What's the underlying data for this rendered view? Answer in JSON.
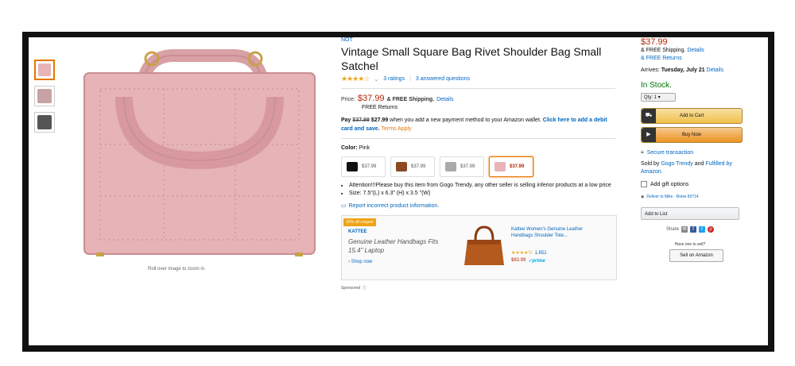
{
  "product": {
    "brand": "NOT",
    "title": "Vintage Small Square Bag Rivet Shoulder Bag Small Satchel",
    "stars": "★★★★☆",
    "ratings_text": "3 ratings",
    "separator": "|",
    "questions_text": "3 answered questions",
    "price_label": "Price:",
    "price": "$37.99",
    "free_shipping": "& FREE Shipping.",
    "details_link": "Details",
    "free_returns": "FREE Returns",
    "promo": {
      "pay_label": "Pay",
      "old_price": "$37.99",
      "new_price": "$27.99",
      "text": "when you add a new payment method to your Amazon wallet.",
      "link": "Click here to add a debit card and save.",
      "terms": "Terms Apply"
    },
    "color_label": "Color:",
    "color_value": "Pink",
    "swatches": [
      {
        "price": "$37.99",
        "color": "#111111"
      },
      {
        "price": "$37.99",
        "color": "#8b4a22"
      },
      {
        "price": "$37.99",
        "color": "#aaaaaa"
      },
      {
        "price": "$37.99",
        "color": "#e8b4b8"
      }
    ],
    "bullets": [
      "Attention!!!Please buy this item from Gogo Trendy, any other seller is selling inferior products at a low price",
      "Size: 7.5\"(L) x 6.3\" (H) x 3.5 \"(W)"
    ],
    "report_text": "Report incorrect product information.",
    "zoom_caption": "Roll over image to zoom in"
  },
  "ad": {
    "badge": "10% off coupon",
    "brand": "KATTEE",
    "headline": "Genuine Leather Handbags Fits 15.4\" Laptop",
    "shop_now": "› Shop now",
    "product_title": "Kattee Women's Genuine Leather Handbags Shoulder Tote...",
    "stars": "★★★★½",
    "review_count": "1,651",
    "price": "$63.99",
    "prime": "✓prime",
    "sponsored": "Sponsored"
  },
  "buybox": {
    "price": "$37.99",
    "free_shipping": "& FREE Shipping.",
    "details": "Details",
    "free_returns": "& FREE Returns",
    "arrives_label": "Arrives:",
    "arrives_date": "Tuesday, July 21",
    "arrives_details": "Details",
    "stock": "In Stock.",
    "qty": "Qty: 1 ▾",
    "add_to_cart": "Add to Cart",
    "buy_now": "Buy Now",
    "secure": "Secure transaction",
    "sold_by_prefix": "Sold by",
    "seller": "Gogo Trendy",
    "sold_by_and": "and",
    "fulfilled": "Fulfilled by Amazon.",
    "gift": "Add gift options",
    "deliver": "Deliver to Mike - Boise 83714",
    "add_to_list": "Add to List",
    "share": "Share",
    "sell_question": "Have one to sell?",
    "sell_button": "Sell on Amazon"
  },
  "colors": {
    "price_red": "#b12704",
    "link_blue": "#0066c0",
    "in_stock_green": "#007600",
    "cart_yellow": "#f0c14b",
    "buy_orange": "#ed9220",
    "bag_pink": "#e8b4b8"
  }
}
